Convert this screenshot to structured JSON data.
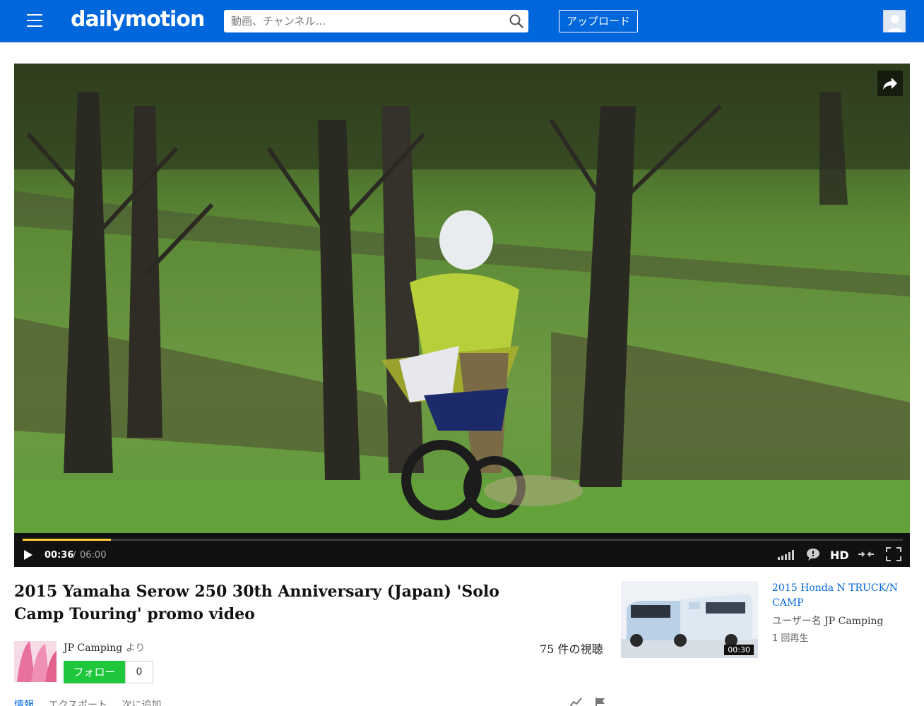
{
  "header": {
    "logo": "dailymotion",
    "search_placeholder": "動画、チャンネル…",
    "upload_label": "アップロード"
  },
  "player": {
    "current_time": "00:36",
    "separator": "/",
    "duration": "06:00",
    "progress_fraction": 0.1,
    "quality_label": "HD"
  },
  "video": {
    "title": "2015 Yamaha Serow 250 30th Anniversary (Japan) 'Solo Camp Touring' promo video",
    "owner_name": "JP Camping",
    "owner_suffix": "より",
    "follow_label": "フォロー",
    "follower_count": "0",
    "views": "75 件の視聴"
  },
  "tabs": [
    {
      "label": "情報"
    },
    {
      "label": "エクスポート"
    },
    {
      "label": "次に追加"
    }
  ],
  "related": [
    {
      "title": "2015 Honda N TRUCK/N CAMP",
      "owner_prefix": "ユーザー名",
      "owner_name": "JP Camping",
      "views": "1 回再生",
      "duration": "00:30"
    }
  ],
  "colors": {
    "brand": "#0066dc",
    "follow": "#1ec63c",
    "progress": "#ffcc33"
  },
  "icons": {
    "menu": "hamburger-icon",
    "search": "search-icon",
    "share": "share-icon",
    "play": "play-icon",
    "volume": "volume-icon",
    "chat": "chat-icon",
    "collapse": "collapse-icon",
    "fullscreen": "fullscreen-icon"
  }
}
